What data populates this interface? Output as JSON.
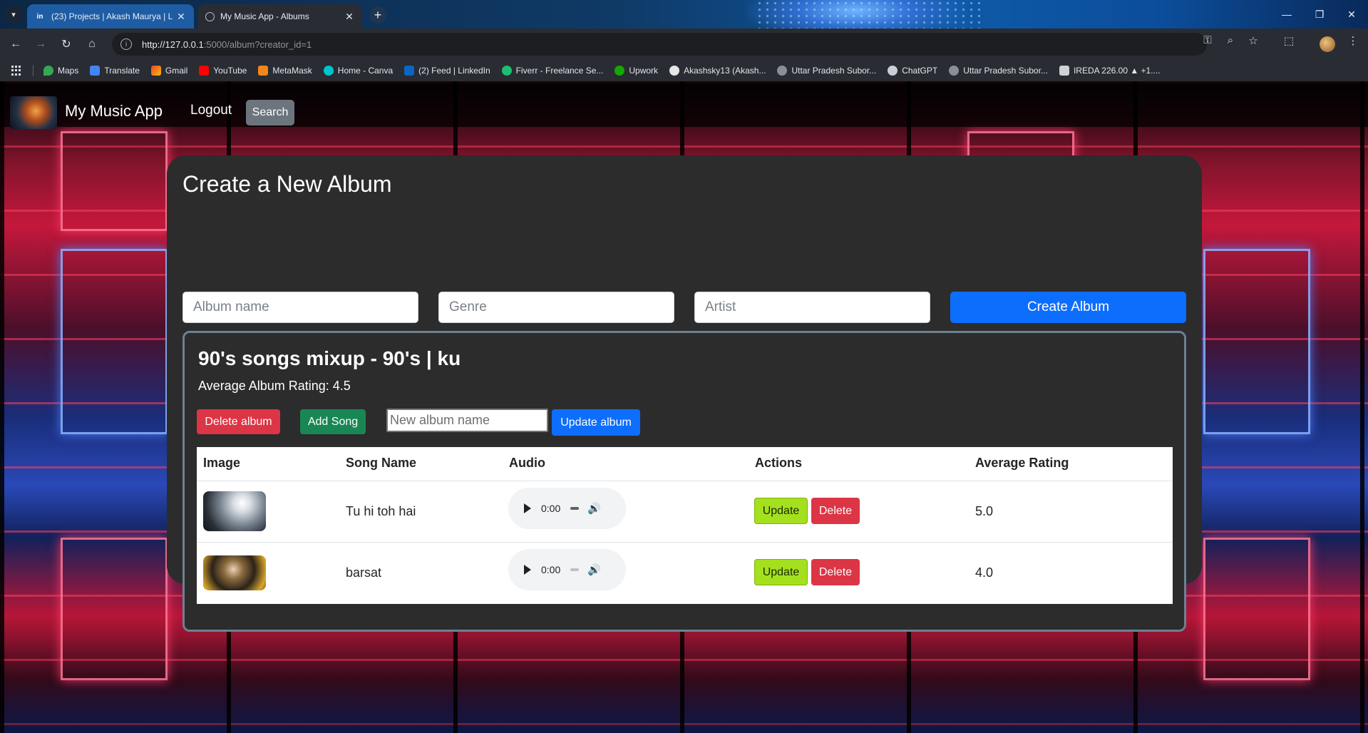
{
  "browser": {
    "tabs": [
      {
        "title": "(23) Projects | Akash Maurya | L",
        "favicon": "linkedin-icon"
      },
      {
        "title": "My Music App - Albums",
        "favicon": "globe-icon"
      }
    ],
    "url_host": "http://127.0.0.1",
    "url_rest": ":5000/album?creator_id=1",
    "bookmarks": [
      "Maps",
      "Translate",
      "Gmail",
      "YouTube",
      "MetaMask",
      "Home - Canva",
      "(2) Feed | LinkedIn",
      "Fiverr - Freelance Se...",
      "Upwork",
      "Akashsky13 (Akash...",
      "Uttar Pradesh Subor...",
      "ChatGPT",
      "Uttar Pradesh Subor...",
      "IREDA 226.00 ▲ +1...."
    ]
  },
  "nav": {
    "brand": "My Music App",
    "logout": "Logout",
    "search": "Search"
  },
  "create": {
    "title": "Create a New Album",
    "album_placeholder": "Album name",
    "genre_placeholder": "Genre",
    "artist_placeholder": "Artist",
    "button": "Create Album"
  },
  "album": {
    "title": "90's songs mixup - 90's | ku",
    "rating": "Average Album Rating: 4.5",
    "delete_label": "Delete album",
    "add_song_label": "Add Song",
    "new_name_placeholder": "New album name",
    "update_label": "Update album"
  },
  "songs": {
    "headers": [
      "Image",
      "Song Name",
      "Audio",
      "Actions",
      "Average Rating"
    ],
    "rows": [
      {
        "name": "Tu hi toh hai",
        "time": "0:00",
        "update": "Update",
        "delete": "Delete",
        "rating": "5.0"
      },
      {
        "name": "barsat",
        "time": "0:00",
        "update": "Update",
        "delete": "Delete",
        "rating": "4.0"
      }
    ]
  },
  "colors": {
    "primary": "#0d6efd",
    "danger": "#dc3545",
    "success": "#198754",
    "lime": "#a5e01e",
    "panel": "#2c2c2c"
  }
}
